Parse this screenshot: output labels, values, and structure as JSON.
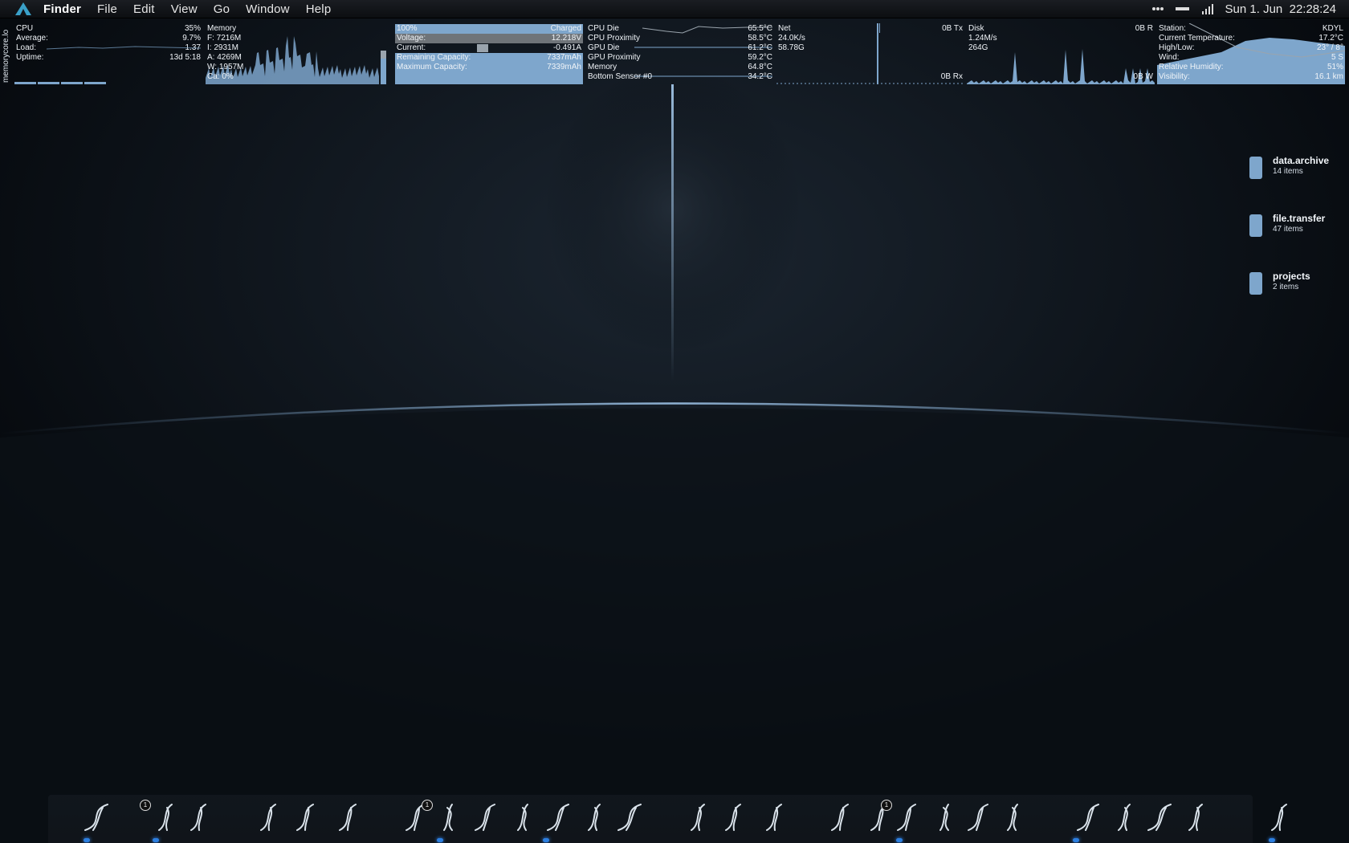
{
  "menubar": {
    "app_name": "Finder",
    "menus": [
      "File",
      "Edit",
      "View",
      "Go",
      "Window",
      "Help"
    ],
    "clock": "Sun 1. Jun  22:28:24"
  },
  "widgets": {
    "host_label": "memorycore.lo",
    "cpu": {
      "title": "CPU",
      "value": "35%",
      "rows": [
        {
          "k": "Average:",
          "v": "9.7%"
        },
        {
          "k": "Load:",
          "v": "1.37"
        },
        {
          "k": "Uptime:",
          "v": "13d 5:18"
        }
      ]
    },
    "memory": {
      "title": "Memory",
      "rows": [
        "F: 7216M",
        "I: 2931M",
        "A: 4269M",
        "W: 1957M",
        "Ca: 0%"
      ]
    },
    "battery": {
      "rows": [
        {
          "k": "100%",
          "v": "Charged"
        },
        {
          "k": "Voltage:",
          "v": "12.218V"
        },
        {
          "k": "Current:",
          "v": "-0.491A"
        },
        {
          "k": "Remaining Capacity:",
          "v": "7337mAh"
        },
        {
          "k": "Maximum Capacity:",
          "v": "7339mAh"
        }
      ]
    },
    "temps": {
      "rows": [
        {
          "k": "CPU Die",
          "v": "65.5°C"
        },
        {
          "k": "CPU Proximity",
          "v": "58.5°C"
        },
        {
          "k": "GPU Die",
          "v": "61.2°C"
        },
        {
          "k": "GPU Proximity",
          "v": "59.2°C"
        },
        {
          "k": "Memory",
          "v": "64.8°C"
        },
        {
          "k": "Bottom Sensor #0",
          "v": "34.2°C"
        }
      ]
    },
    "net": {
      "title": "Net",
      "tx": "0B Tx",
      "rx": "0B Rx",
      "rate": "24.0K/s",
      "total": "58.78G"
    },
    "disk": {
      "title": "Disk",
      "read": "0B R",
      "write": "0B W",
      "rate": "1.24M/s",
      "total": "264G"
    },
    "weather": {
      "rows": [
        {
          "k": "Station:",
          "v": "KDYL"
        },
        {
          "k": "Current Temperature:",
          "v": "17.2°C"
        },
        {
          "k": "High/Low:",
          "v": "23° / 8°"
        },
        {
          "k": "Wind:",
          "v": "5 S"
        },
        {
          "k": "Relative Humidity:",
          "v": "51%"
        },
        {
          "k": "Visibility:",
          "v": "16.1 km"
        }
      ]
    }
  },
  "desktop": {
    "folders": [
      {
        "name": "data.archive",
        "count": "14 items"
      },
      {
        "name": "file.transfer",
        "count": "47 items"
      },
      {
        "name": "projects",
        "count": "2 items"
      }
    ]
  },
  "dock": {
    "badges": [
      "1",
      "1",
      "1"
    ]
  },
  "colors": {
    "accent": "#7ea6cc",
    "background": "#05080c",
    "indicator": "#2c7fe0"
  }
}
